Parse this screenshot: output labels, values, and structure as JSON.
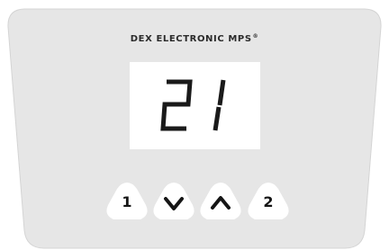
{
  "brand": {
    "name": "DEX ELECTRONIC MPS",
    "mark": "®"
  },
  "display": {
    "value": "21"
  },
  "buttons": [
    {
      "id": "preset-1",
      "label": "1",
      "icon": null
    },
    {
      "id": "down",
      "label": "",
      "icon": "chevron-down-icon"
    },
    {
      "id": "up",
      "label": "",
      "icon": "chevron-up-icon"
    },
    {
      "id": "preset-2",
      "label": "2",
      "icon": null
    }
  ],
  "colors": {
    "panel": "#e6e6e6",
    "panel_border": "#cfcfcf",
    "button_fill": "#ffffff",
    "segment": "#1a1a1a",
    "text": "#2a2a2a"
  }
}
